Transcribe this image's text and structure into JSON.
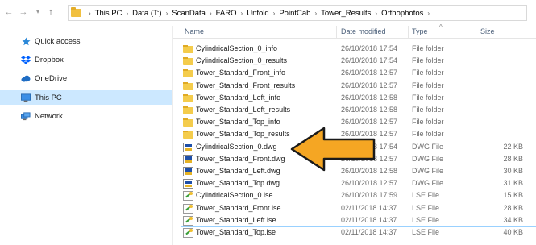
{
  "nav": {
    "back": "←",
    "forward": "→",
    "recent": "▾",
    "up": "↑"
  },
  "address": {
    "breadcrumbs": [
      "This PC",
      "Data (T:)",
      "ScanData",
      "FARO",
      "Unfold",
      "PointCab",
      "Tower_Results",
      "Orthophotos"
    ],
    "separator": "›"
  },
  "sidebar": {
    "items": [
      {
        "label": "Quick access",
        "icon": "star-pin-icon"
      },
      {
        "label": "Dropbox",
        "icon": "dropbox-icon"
      },
      {
        "label": "OneDrive",
        "icon": "cloud-icon"
      },
      {
        "label": "This PC",
        "icon": "computer-icon",
        "selected": true
      },
      {
        "label": "Network",
        "icon": "network-icon"
      }
    ]
  },
  "columns": {
    "name": "Name",
    "date": "Date modified",
    "type": "Type",
    "size": "Size",
    "sort_indicator": "^"
  },
  "files": [
    {
      "name": "CylindricalSection_0_info",
      "date": "26/10/2018 17:54",
      "type": "File folder",
      "size": "",
      "icon": "folder"
    },
    {
      "name": "CylindricalSection_0_results",
      "date": "26/10/2018 17:54",
      "type": "File folder",
      "size": "",
      "icon": "folder"
    },
    {
      "name": "Tower_Standard_Front_info",
      "date": "26/10/2018 12:57",
      "type": "File folder",
      "size": "",
      "icon": "folder"
    },
    {
      "name": "Tower_Standard_Front_results",
      "date": "26/10/2018 12:57",
      "type": "File folder",
      "size": "",
      "icon": "folder"
    },
    {
      "name": "Tower_Standard_Left_info",
      "date": "26/10/2018 12:58",
      "type": "File folder",
      "size": "",
      "icon": "folder"
    },
    {
      "name": "Tower_Standard_Left_results",
      "date": "26/10/2018 12:58",
      "type": "File folder",
      "size": "",
      "icon": "folder"
    },
    {
      "name": "Tower_Standard_Top_info",
      "date": "26/10/2018 12:57",
      "type": "File folder",
      "size": "",
      "icon": "folder"
    },
    {
      "name": "Tower_Standard_Top_results",
      "date": "26/10/2018 12:57",
      "type": "File folder",
      "size": "",
      "icon": "folder"
    },
    {
      "name": "CylindricalSection_0.dwg",
      "date": "26/10/2018 17:54",
      "type": "DWG File",
      "size": "22 KB",
      "icon": "dwg"
    },
    {
      "name": "Tower_Standard_Front.dwg",
      "date": "26/10/2018 12:57",
      "type": "DWG File",
      "size": "28 KB",
      "icon": "dwg"
    },
    {
      "name": "Tower_Standard_Left.dwg",
      "date": "26/10/2018 12:58",
      "type": "DWG File",
      "size": "30 KB",
      "icon": "dwg"
    },
    {
      "name": "Tower_Standard_Top.dwg",
      "date": "26/10/2018 12:57",
      "type": "DWG File",
      "size": "31 KB",
      "icon": "dwg"
    },
    {
      "name": "CylindricalSection_0.lse",
      "date": "26/10/2018 17:59",
      "type": "LSE File",
      "size": "15 KB",
      "icon": "lse"
    },
    {
      "name": "Tower_Standard_Front.lse",
      "date": "02/11/2018 14:37",
      "type": "LSE File",
      "size": "28 KB",
      "icon": "lse"
    },
    {
      "name": "Tower_Standard_Left.lse",
      "date": "02/11/2018 14:37",
      "type": "LSE File",
      "size": "34 KB",
      "icon": "lse"
    },
    {
      "name": "Tower_Standard_Top.lse",
      "date": "02/11/2018 14:37",
      "type": "LSE File",
      "size": "40 KB",
      "icon": "lse",
      "selected": true
    }
  ],
  "annotation": {
    "icon": "orange-arrow-icon",
    "color": "#f5a623",
    "outline": "#1a1a1a"
  },
  "colors": {
    "selected_bg": "#cce8ff",
    "header_text": "#4c607a"
  }
}
